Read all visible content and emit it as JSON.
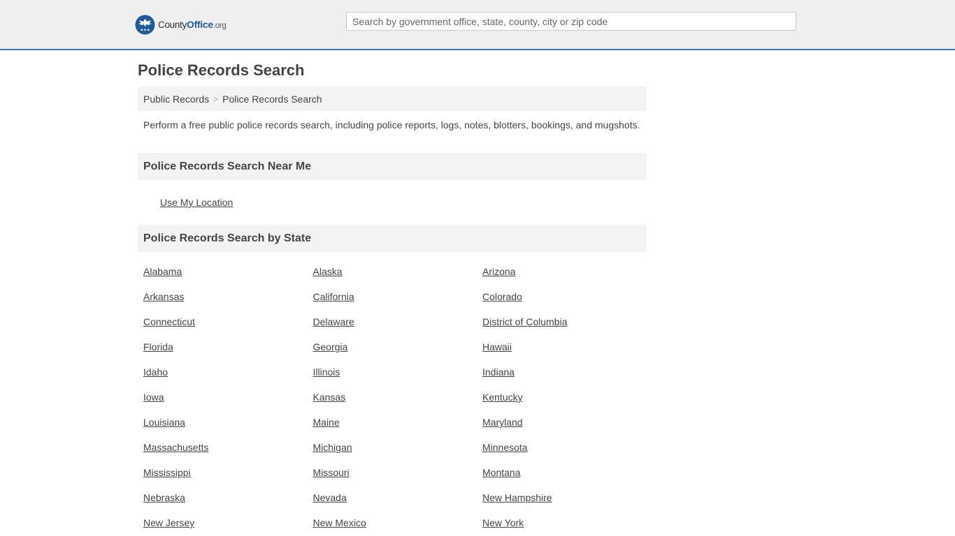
{
  "header": {
    "logo": {
      "prefix": "County",
      "brand": "Office",
      "tld": ".org"
    },
    "search_placeholder": "Search by government office, state, county, city or zip code"
  },
  "page": {
    "title": "Police Records Search",
    "breadcrumb": {
      "items": [
        "Public Records",
        "Police Records Search"
      ],
      "separator": ">"
    },
    "intro": "Perform a free public police records search, including police reports, logs, notes, blotters, bookings, and mugshots.",
    "near_me": {
      "heading": "Police Records Search Near Me",
      "link": "Use My Location"
    },
    "by_state": {
      "heading": "Police Records Search by State",
      "states": [
        "Alabama",
        "Alaska",
        "Arizona",
        "Arkansas",
        "California",
        "Colorado",
        "Connecticut",
        "Delaware",
        "District of Columbia",
        "Florida",
        "Georgia",
        "Hawaii",
        "Idaho",
        "Illinois",
        "Indiana",
        "Iowa",
        "Kansas",
        "Kentucky",
        "Louisiana",
        "Maine",
        "Maryland",
        "Massachusetts",
        "Michigan",
        "Minnesota",
        "Mississippi",
        "Missouri",
        "Montana",
        "Nebraska",
        "Nevada",
        "New Hampshire",
        "New Jersey",
        "New Mexico",
        "New York"
      ]
    }
  },
  "colors": {
    "header_bg": "#efefef",
    "header_border": "#3d7ab8",
    "brand_blue": "#1f5b99",
    "panel_bg": "#f3f3f3",
    "text": "#444444"
  },
  "icons": {
    "logo": "eagle-seal-icon"
  }
}
